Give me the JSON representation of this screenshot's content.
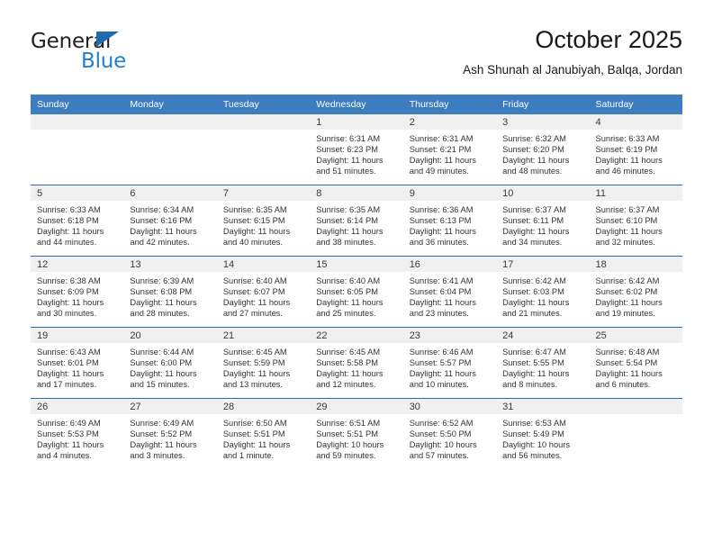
{
  "brand": {
    "name_top": "General",
    "name_bottom": "Blue",
    "color_black": "#231f20",
    "color_blue": "#1f7fd0",
    "triangle_color": "#1f6bb0"
  },
  "header": {
    "title": "October 2025",
    "subtitle": "Ash Shunah al Janubiyah, Balqa, Jordan"
  },
  "theme": {
    "header_row_bg": "#3b7dbf",
    "row_divider": "#2a6ca8",
    "daynum_band_bg": "#f0f0f0"
  },
  "calendar": {
    "weekday_headers": [
      "Sunday",
      "Monday",
      "Tuesday",
      "Wednesday",
      "Thursday",
      "Friday",
      "Saturday"
    ],
    "weeks": [
      [
        {
          "day": "",
          "sunrise": "",
          "sunset": "",
          "daylight1": "",
          "daylight2": "",
          "empty": true
        },
        {
          "day": "",
          "sunrise": "",
          "sunset": "",
          "daylight1": "",
          "daylight2": "",
          "empty": true
        },
        {
          "day": "",
          "sunrise": "",
          "sunset": "",
          "daylight1": "",
          "daylight2": "",
          "empty": true
        },
        {
          "day": "1",
          "sunrise": "Sunrise: 6:31 AM",
          "sunset": "Sunset: 6:23 PM",
          "daylight1": "Daylight: 11 hours",
          "daylight2": "and 51 minutes."
        },
        {
          "day": "2",
          "sunrise": "Sunrise: 6:31 AM",
          "sunset": "Sunset: 6:21 PM",
          "daylight1": "Daylight: 11 hours",
          "daylight2": "and 49 minutes."
        },
        {
          "day": "3",
          "sunrise": "Sunrise: 6:32 AM",
          "sunset": "Sunset: 6:20 PM",
          "daylight1": "Daylight: 11 hours",
          "daylight2": "and 48 minutes."
        },
        {
          "day": "4",
          "sunrise": "Sunrise: 6:33 AM",
          "sunset": "Sunset: 6:19 PM",
          "daylight1": "Daylight: 11 hours",
          "daylight2": "and 46 minutes."
        }
      ],
      [
        {
          "day": "5",
          "sunrise": "Sunrise: 6:33 AM",
          "sunset": "Sunset: 6:18 PM",
          "daylight1": "Daylight: 11 hours",
          "daylight2": "and 44 minutes."
        },
        {
          "day": "6",
          "sunrise": "Sunrise: 6:34 AM",
          "sunset": "Sunset: 6:16 PM",
          "daylight1": "Daylight: 11 hours",
          "daylight2": "and 42 minutes."
        },
        {
          "day": "7",
          "sunrise": "Sunrise: 6:35 AM",
          "sunset": "Sunset: 6:15 PM",
          "daylight1": "Daylight: 11 hours",
          "daylight2": "and 40 minutes."
        },
        {
          "day": "8",
          "sunrise": "Sunrise: 6:35 AM",
          "sunset": "Sunset: 6:14 PM",
          "daylight1": "Daylight: 11 hours",
          "daylight2": "and 38 minutes."
        },
        {
          "day": "9",
          "sunrise": "Sunrise: 6:36 AM",
          "sunset": "Sunset: 6:13 PM",
          "daylight1": "Daylight: 11 hours",
          "daylight2": "and 36 minutes."
        },
        {
          "day": "10",
          "sunrise": "Sunrise: 6:37 AM",
          "sunset": "Sunset: 6:11 PM",
          "daylight1": "Daylight: 11 hours",
          "daylight2": "and 34 minutes."
        },
        {
          "day": "11",
          "sunrise": "Sunrise: 6:37 AM",
          "sunset": "Sunset: 6:10 PM",
          "daylight1": "Daylight: 11 hours",
          "daylight2": "and 32 minutes."
        }
      ],
      [
        {
          "day": "12",
          "sunrise": "Sunrise: 6:38 AM",
          "sunset": "Sunset: 6:09 PM",
          "daylight1": "Daylight: 11 hours",
          "daylight2": "and 30 minutes."
        },
        {
          "day": "13",
          "sunrise": "Sunrise: 6:39 AM",
          "sunset": "Sunset: 6:08 PM",
          "daylight1": "Daylight: 11 hours",
          "daylight2": "and 28 minutes."
        },
        {
          "day": "14",
          "sunrise": "Sunrise: 6:40 AM",
          "sunset": "Sunset: 6:07 PM",
          "daylight1": "Daylight: 11 hours",
          "daylight2": "and 27 minutes."
        },
        {
          "day": "15",
          "sunrise": "Sunrise: 6:40 AM",
          "sunset": "Sunset: 6:05 PM",
          "daylight1": "Daylight: 11 hours",
          "daylight2": "and 25 minutes."
        },
        {
          "day": "16",
          "sunrise": "Sunrise: 6:41 AM",
          "sunset": "Sunset: 6:04 PM",
          "daylight1": "Daylight: 11 hours",
          "daylight2": "and 23 minutes."
        },
        {
          "day": "17",
          "sunrise": "Sunrise: 6:42 AM",
          "sunset": "Sunset: 6:03 PM",
          "daylight1": "Daylight: 11 hours",
          "daylight2": "and 21 minutes."
        },
        {
          "day": "18",
          "sunrise": "Sunrise: 6:42 AM",
          "sunset": "Sunset: 6:02 PM",
          "daylight1": "Daylight: 11 hours",
          "daylight2": "and 19 minutes."
        }
      ],
      [
        {
          "day": "19",
          "sunrise": "Sunrise: 6:43 AM",
          "sunset": "Sunset: 6:01 PM",
          "daylight1": "Daylight: 11 hours",
          "daylight2": "and 17 minutes."
        },
        {
          "day": "20",
          "sunrise": "Sunrise: 6:44 AM",
          "sunset": "Sunset: 6:00 PM",
          "daylight1": "Daylight: 11 hours",
          "daylight2": "and 15 minutes."
        },
        {
          "day": "21",
          "sunrise": "Sunrise: 6:45 AM",
          "sunset": "Sunset: 5:59 PM",
          "daylight1": "Daylight: 11 hours",
          "daylight2": "and 13 minutes."
        },
        {
          "day": "22",
          "sunrise": "Sunrise: 6:45 AM",
          "sunset": "Sunset: 5:58 PM",
          "daylight1": "Daylight: 11 hours",
          "daylight2": "and 12 minutes."
        },
        {
          "day": "23",
          "sunrise": "Sunrise: 6:46 AM",
          "sunset": "Sunset: 5:57 PM",
          "daylight1": "Daylight: 11 hours",
          "daylight2": "and 10 minutes."
        },
        {
          "day": "24",
          "sunrise": "Sunrise: 6:47 AM",
          "sunset": "Sunset: 5:55 PM",
          "daylight1": "Daylight: 11 hours",
          "daylight2": "and 8 minutes."
        },
        {
          "day": "25",
          "sunrise": "Sunrise: 6:48 AM",
          "sunset": "Sunset: 5:54 PM",
          "daylight1": "Daylight: 11 hours",
          "daylight2": "and 6 minutes."
        }
      ],
      [
        {
          "day": "26",
          "sunrise": "Sunrise: 6:49 AM",
          "sunset": "Sunset: 5:53 PM",
          "daylight1": "Daylight: 11 hours",
          "daylight2": "and 4 minutes."
        },
        {
          "day": "27",
          "sunrise": "Sunrise: 6:49 AM",
          "sunset": "Sunset: 5:52 PM",
          "daylight1": "Daylight: 11 hours",
          "daylight2": "and 3 minutes."
        },
        {
          "day": "28",
          "sunrise": "Sunrise: 6:50 AM",
          "sunset": "Sunset: 5:51 PM",
          "daylight1": "Daylight: 11 hours",
          "daylight2": "and 1 minute."
        },
        {
          "day": "29",
          "sunrise": "Sunrise: 6:51 AM",
          "sunset": "Sunset: 5:51 PM",
          "daylight1": "Daylight: 10 hours",
          "daylight2": "and 59 minutes."
        },
        {
          "day": "30",
          "sunrise": "Sunrise: 6:52 AM",
          "sunset": "Sunset: 5:50 PM",
          "daylight1": "Daylight: 10 hours",
          "daylight2": "and 57 minutes."
        },
        {
          "day": "31",
          "sunrise": "Sunrise: 6:53 AM",
          "sunset": "Sunset: 5:49 PM",
          "daylight1": "Daylight: 10 hours",
          "daylight2": "and 56 minutes."
        },
        {
          "day": "",
          "sunrise": "",
          "sunset": "",
          "daylight1": "",
          "daylight2": "",
          "empty": true
        }
      ]
    ]
  }
}
